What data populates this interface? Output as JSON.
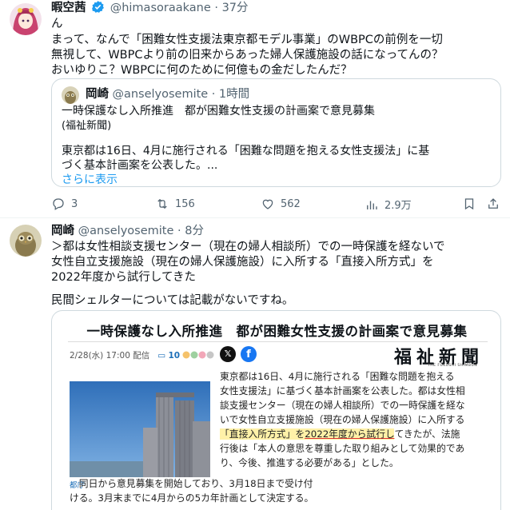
{
  "tweet1": {
    "author": "暇空茜",
    "handle": "@himasoraakane",
    "time": "· 37分",
    "text_lines": [
      "ん",
      "まって、なんで「困難女性支援法東京都モデル事業」のWBPCの前例を一切",
      "無視して、WBPCより前の旧来からあった婦人保護施設の話になってんの？",
      "おいゆりこ？WBPCに何のために何億もの金だしたんだ？"
    ],
    "quote": {
      "author": "岡崎",
      "handle": "@anselyosemite",
      "time": "· 1時間",
      "lines": [
        "一時保護なし入所推進　都が困難女性支援の計画案で意見募集",
        "(福祉新聞)",
        "東京都は16日、4月に施行される「困難な問題を抱える女性支援法」に基",
        "づく基本計画案を公表した。..."
      ],
      "show_more": "さらに表示"
    },
    "actions": {
      "replies": "3",
      "reposts": "156",
      "likes": "562",
      "views": "2.9万"
    }
  },
  "tweet2": {
    "author": "岡崎",
    "handle": "@anselyosemite",
    "time": "· 8分",
    "text_lines": [
      "＞都は女性相談支援センター（現在の婦人相談所）での一時保護を経ないで",
      "女性自立支援施設（現在の婦人保護施設）に入所する「直接入所方式」を",
      "2022年度から試行してきた",
      "民間シェルターについては記載がないですね。"
    ],
    "article": {
      "title": "一時保護なし入所推進　都が困難女性支援の計画案で意見募集",
      "date": "2/28(水) 17:00 配信",
      "comment_count": "10",
      "logo": "福祉新聞",
      "logo_sub": "THE FUKUSHI SHIMBUN",
      "photo_caption": "都庁",
      "body_lines": [
        "東京都は16日、4月に施行される「困難な問題を抱える",
        "女性支援法」に基づく基本計画案を公表した。都は女性相",
        "談支援センター（現在の婦人相談所）での一時保護を経な",
        "いで女性自立支援施設（現在の婦人保護施設）に入所する",
        "「直接入所方式」を2022年度から試行してきたが、法施",
        "行後は「本人の意思を尊重した取り組みとして効果的であ",
        "り、今後、推進する必要がある」とした。"
      ],
      "body_hl_a": "「直接入所方式」を",
      "body_hl_b": "2022年度から試行し",
      "body_hl_c": "てきたが、法施",
      "body_full_lines": [
        "　同日から意見募集を開始しており、3月18日まで受け付",
        "ける。3月末までに4月からの5カ年計画として決定する。"
      ]
    }
  },
  "colors": {
    "accent": "#1d9bf0",
    "muted": "#536471",
    "border": "#cfd9de",
    "verified": "#1d9bf0"
  },
  "icons": [
    "verified-badge-icon",
    "reply-icon",
    "repost-icon",
    "like-icon",
    "views-icon",
    "x-logo-icon",
    "facebook-icon"
  ]
}
